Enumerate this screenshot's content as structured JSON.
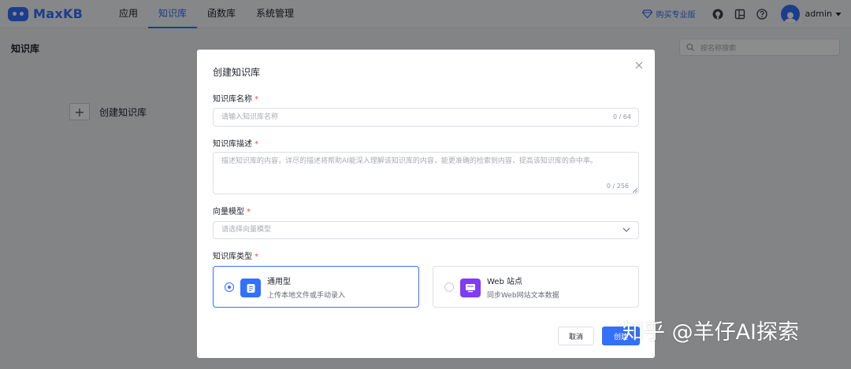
{
  "app": {
    "name": "MaxKB",
    "brand_color": "#3370ff"
  },
  "nav": {
    "items": [
      {
        "label": "应用",
        "active": false
      },
      {
        "label": "知识库",
        "active": true
      },
      {
        "label": "函数库",
        "active": false
      },
      {
        "label": "系统管理",
        "active": false
      }
    ]
  },
  "header": {
    "buy_label": "购买专业版",
    "icons": [
      "github-icon",
      "document-icon",
      "help-icon"
    ],
    "user_name": "admin"
  },
  "page": {
    "title": "知识库",
    "search_placeholder": "按名称搜索",
    "create_label": "创建知识库"
  },
  "modal": {
    "title": "创建知识库",
    "name_field": {
      "label": "知识库名称",
      "required_mark": "*",
      "placeholder": "请输入知识库名称",
      "count": "0 / 64"
    },
    "desc_field": {
      "label": "知识库描述",
      "required_mark": "*",
      "placeholder": "描述知识库的内容，详尽的描述将帮助AI能深入理解该知识库的内容，能更准确的检索到内容，提高该知识库的命中率。",
      "count": "0 / 256"
    },
    "model_field": {
      "label": "向量模型",
      "required_mark": "*",
      "placeholder": "请选择向量模型"
    },
    "type_field": {
      "label": "知识库类型",
      "required_mark": "*",
      "options": [
        {
          "name": "通用型",
          "desc": "上传本地文件或手动录入",
          "selected": true,
          "icon": "document-icon",
          "icon_color": "#3370ff"
        },
        {
          "name": "Web 站点",
          "desc": "同步Web网站文本数据",
          "selected": false,
          "icon": "monitor-icon",
          "icon_color": "#7f3bf5"
        }
      ]
    },
    "cancel_label": "取消",
    "create_label": "创建"
  },
  "watermark": "知乎 @羊仔AI探索"
}
